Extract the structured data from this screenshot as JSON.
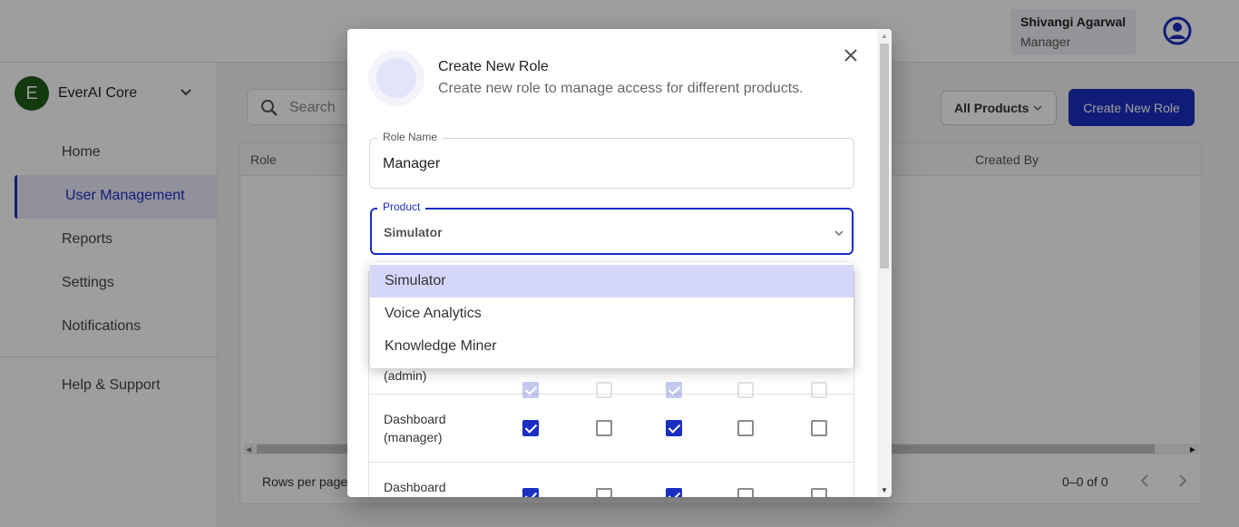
{
  "header": {
    "user_name": "Shivangi Agarwal",
    "user_role": "Manager",
    "avatar_icon": "account-circle-icon"
  },
  "sidebar": {
    "org_initial": "E",
    "org_name": "EverAI Core",
    "items": [
      {
        "label": "Home"
      },
      {
        "label": "User Management",
        "active": true
      },
      {
        "label": "Reports"
      },
      {
        "label": "Settings"
      },
      {
        "label": "Notifications"
      },
      {
        "label": "Help & Support"
      }
    ]
  },
  "main": {
    "search_placeholder": "Search",
    "filter_label": "All Products",
    "create_button": "Create New Role",
    "table": {
      "columns": [
        "Role",
        "Created By"
      ]
    },
    "footer": {
      "rows_per_page": "Rows per page",
      "count": "0–0 of 0"
    }
  },
  "modal": {
    "title": "Create New Role",
    "subtitle": "Create new role to manage access for different products.",
    "role_name_label": "Role Name",
    "role_name_value": "Manager",
    "product_label": "Product",
    "product_value": "Simulator",
    "dropdown_options": [
      "Simulator",
      "Voice Analytics",
      "Knowledge Miner"
    ],
    "permission_rows": [
      {
        "label": "(admin)",
        "checks": [
          true,
          false,
          true,
          false,
          false
        ]
      },
      {
        "label": "Dashboard (manager)",
        "checks": [
          true,
          false,
          true,
          false,
          false
        ]
      },
      {
        "label": "Dashboard",
        "checks": [
          true,
          false,
          true,
          false,
          false
        ]
      }
    ]
  },
  "colors": {
    "accent": "#1a2fc2",
    "org_badge": "#1f5c19",
    "selected_option": "#d4d7f9"
  }
}
